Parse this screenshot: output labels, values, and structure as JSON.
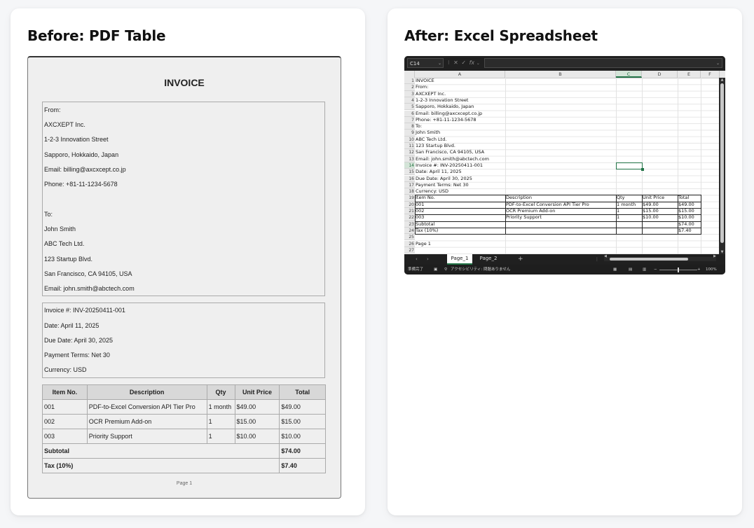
{
  "left_card": {
    "title": "Before: PDF Table"
  },
  "right_card": {
    "title": "After: Excel Spreadsheet"
  },
  "pdf": {
    "heading": "INVOICE",
    "from_lines": [
      "From:",
      "AXCXEPT Inc.",
      "1-2-3 Innovation Street",
      "Sapporo, Hokkaido, Japan",
      "Email: billing@axcxcept.co.jp",
      "Phone: +81-11-1234-5678"
    ],
    "to_lines": [
      "To:",
      "John Smith",
      "ABC Tech Ltd.",
      "123 Startup Blvd.",
      "San Francisco, CA 94105, USA",
      "Email: john.smith@abctech.com"
    ],
    "info_lines": [
      "Invoice #: INV-20250411-001",
      "Date: April 11, 2025",
      "Due Date: April 30, 2025",
      "Payment Terms: Net 30",
      "Currency: USD"
    ],
    "table": {
      "headers": [
        "Item No.",
        "Description",
        "Qty",
        "Unit Price",
        "Total"
      ],
      "rows": [
        [
          "001",
          "PDF-to-Excel Conversion API Tier Pro",
          "1 month",
          "$49.00",
          "$49.00"
        ],
        [
          "002",
          "OCR Premium Add-on",
          "1",
          "$15.00",
          "$15.00"
        ],
        [
          "003",
          "Priority Support",
          "1",
          "$10.00",
          "$10.00"
        ]
      ],
      "subtotal_label": "Subtotal",
      "subtotal_value": "$74.00",
      "tax_label": "Tax (10%)",
      "tax_value": "$7.40"
    },
    "page_label": "Page 1"
  },
  "excel": {
    "name_box": "C14",
    "fx_label": "fx",
    "columns": [
      "A",
      "B",
      "C",
      "D",
      "E",
      "F"
    ],
    "selected_column": "C",
    "selected_row": "14",
    "row_numbers": [
      "1",
      "2",
      "3",
      "4",
      "5",
      "6",
      "7",
      "8",
      "9",
      "10",
      "11",
      "12",
      "13",
      "14",
      "15",
      "16",
      "17",
      "18",
      "19",
      "20",
      "21",
      "22",
      "23",
      "24",
      "25",
      "26",
      "27"
    ],
    "col_a": [
      "INVOICE",
      "From:",
      "AXCXEPT Inc.",
      "1-2-3 Innovation Street",
      "Sapporo, Hokkaido, Japan",
      "Email: billing@axcxcept.co.jp",
      "Phone: +81-11-1234-5678",
      "To:",
      "John Smith",
      "ABC Tech Ltd.",
      "123 Startup Blvd.",
      "San Francisco, CA 94105, USA",
      "Email: john.smith@abctech.com",
      "Invoice #: INV-20250411-001",
      "Date: April 11, 2025",
      "Due Date: April 30, 2025",
      "Payment Terms: Net 30",
      "Currency: USD",
      "Item No.",
      "001",
      "002",
      "003",
      "Subtotal",
      "Tax (10%)",
      "",
      "Page 1",
      ""
    ],
    "table_rows": [
      [
        "Description",
        "Qty",
        "Unit Price",
        "Total"
      ],
      [
        "PDF-to-Excel Conversion API Tier Pro",
        "1 month",
        "$49.00",
        "$49.00"
      ],
      [
        "OCR Premium Add-on",
        "1",
        "$15.00",
        "$15.00"
      ],
      [
        "Priority Support",
        "1",
        "$10.00",
        "$10.00"
      ],
      [
        "",
        "",
        "",
        "$74.00"
      ],
      [
        "",
        "",
        "",
        "$7.40"
      ]
    ],
    "sheet_tabs": [
      "Page_1",
      "Page_2"
    ],
    "active_tab": "Page_1",
    "status_ready": "準備完了",
    "status_accessibility": "アクセシビリティ: 問題ありません",
    "zoom": "100%"
  }
}
